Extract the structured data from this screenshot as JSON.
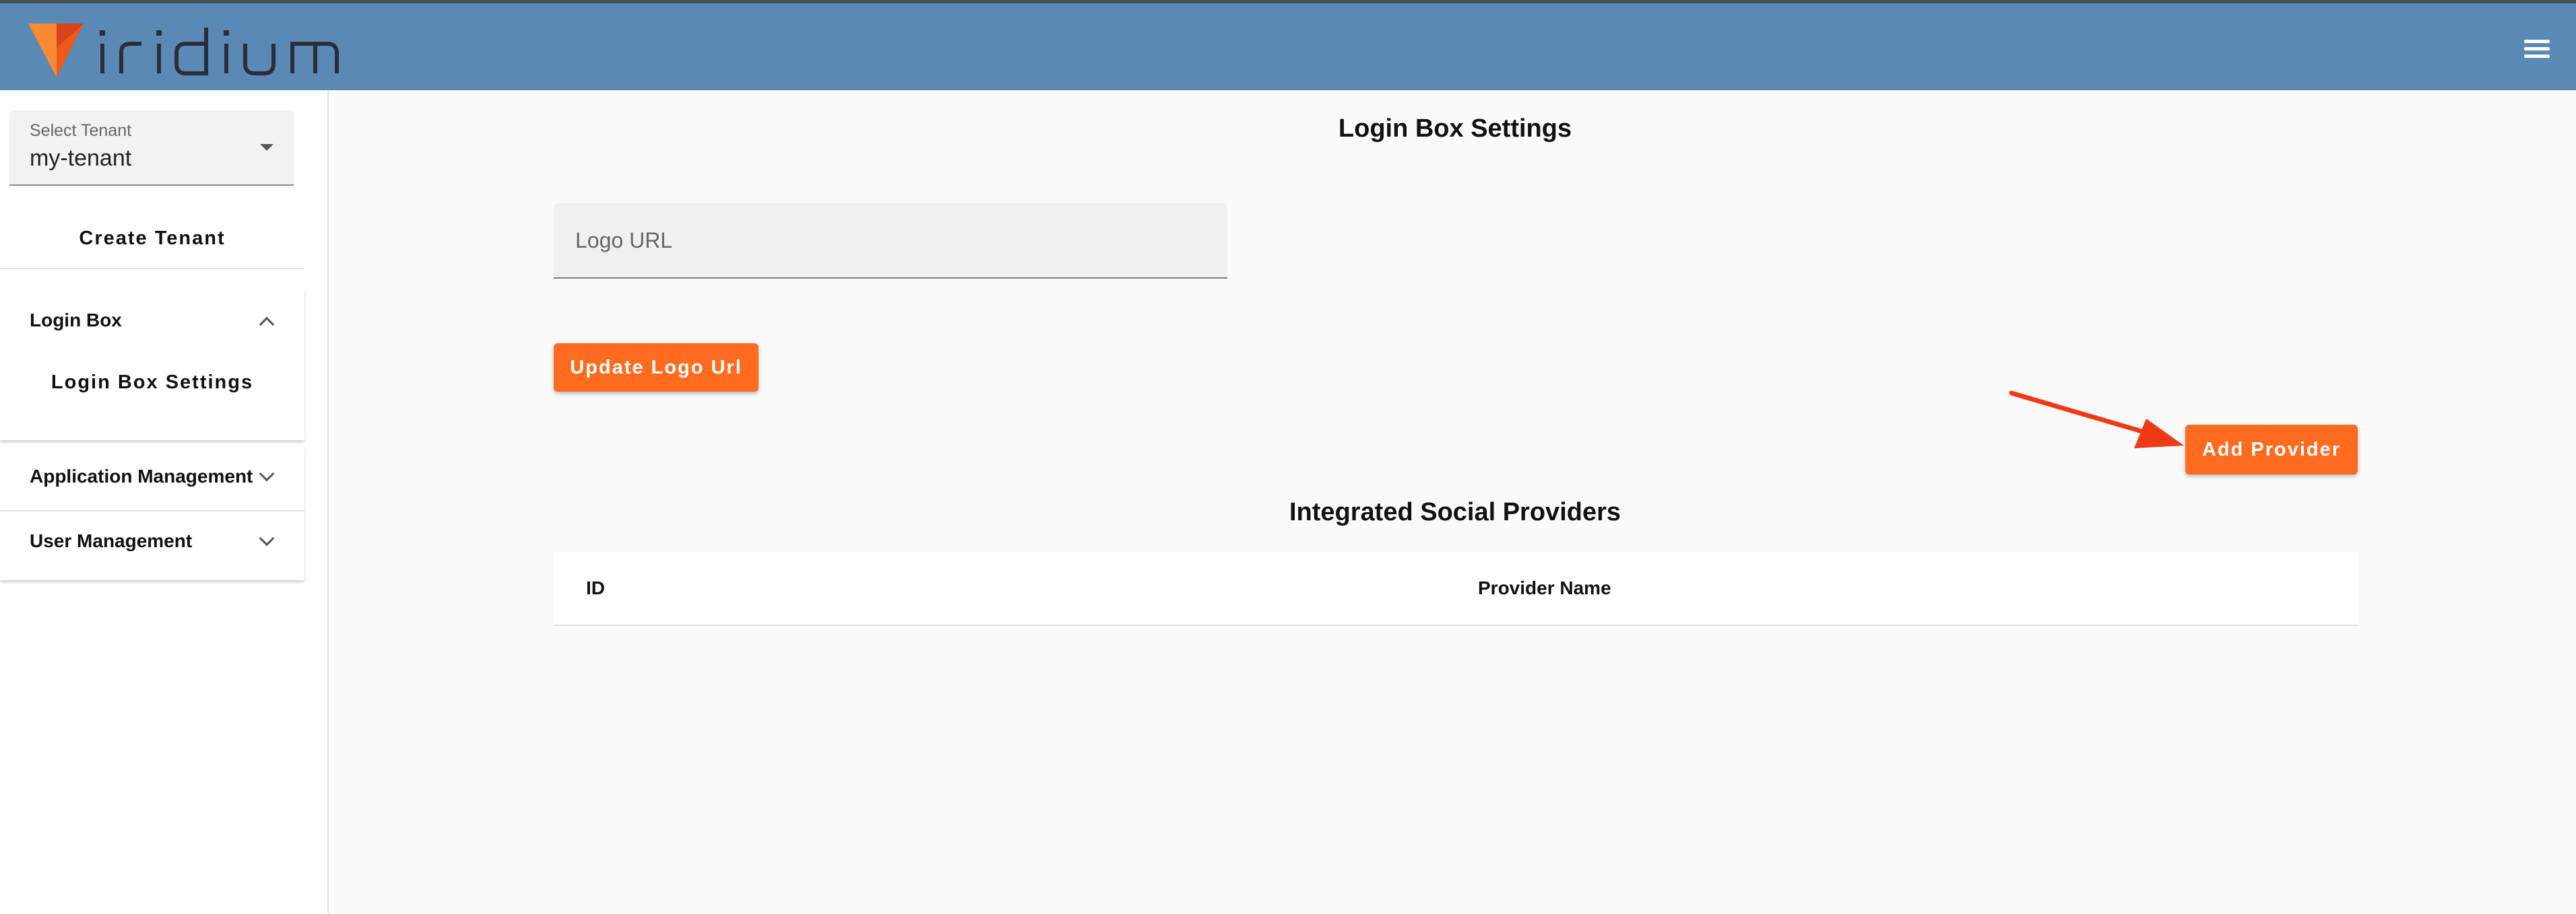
{
  "app": {
    "brand": "iridium",
    "menu_icon": "hamburger-menu-icon"
  },
  "colors": {
    "header": "#5b89b5",
    "accent": "#ff6b1f",
    "arrow": "#f03a17"
  },
  "sidebar": {
    "tenant_select": {
      "label": "Select Tenant",
      "value": "my-tenant"
    },
    "create_tenant_label": "Create Tenant",
    "sections": [
      {
        "title": "Login Box",
        "expanded": true,
        "items": [
          "Login Box Settings"
        ]
      },
      {
        "title": "Application Management",
        "expanded": false
      },
      {
        "title": "User Management",
        "expanded": false
      }
    ]
  },
  "main": {
    "title": "Login Box Settings",
    "logo_url": {
      "placeholder": "Logo URL",
      "value": ""
    },
    "update_button": "Update Logo Url",
    "add_provider_button": "Add Provider",
    "providers_title": "Integrated Social Providers",
    "table": {
      "columns": [
        "ID",
        "Provider Name"
      ],
      "rows": []
    }
  }
}
